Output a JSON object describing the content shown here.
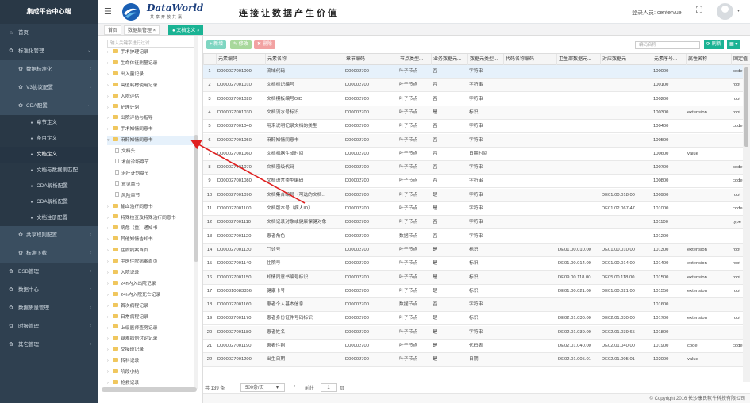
{
  "sidebar": {
    "brand": "集成平台中心端",
    "items": [
      {
        "label": "首页",
        "icon": "home-icon",
        "glyph": "⌂",
        "level": 1,
        "chev": ""
      },
      {
        "label": "标准化管理",
        "icon": "gear-icon",
        "glyph": "✿",
        "level": 1,
        "chev": "⌄"
      },
      {
        "label": "数据标准化",
        "icon": "gear-icon",
        "glyph": "✿",
        "level": 2,
        "chev": "‹"
      },
      {
        "label": "V3协议配置",
        "icon": "gear-icon",
        "glyph": "✿",
        "level": 2,
        "chev": "‹"
      },
      {
        "label": "CDA配置",
        "icon": "gear-icon",
        "glyph": "✿",
        "level": 2,
        "chev": "⌄"
      },
      {
        "label": "章节定义",
        "icon": "circle-icon",
        "glyph": "●",
        "level": 3
      },
      {
        "label": "条目定义",
        "icon": "circle-icon",
        "glyph": "●",
        "level": 3
      },
      {
        "label": "文档定义",
        "icon": "circle-icon",
        "glyph": "●",
        "level": 3,
        "active": true
      },
      {
        "label": "文档与数据集匹配",
        "icon": "circle-icon",
        "glyph": "●",
        "level": 3
      },
      {
        "label": "CDA解析配置",
        "icon": "circle-icon",
        "glyph": "●",
        "level": 3
      },
      {
        "label": "CDA解析配置",
        "icon": "circle-icon",
        "glyph": "●",
        "level": 3
      },
      {
        "label": "文档注册配置",
        "icon": "circle-icon",
        "glyph": "●",
        "level": 3
      },
      {
        "label": "共享规则配置",
        "icon": "gear-icon",
        "glyph": "✿",
        "level": 2,
        "chev": "‹"
      },
      {
        "label": "标准下载",
        "icon": "gear-icon",
        "glyph": "✿",
        "level": 2,
        "chev": "‹"
      },
      {
        "label": "ESB管理",
        "icon": "gear-icon",
        "glyph": "✿",
        "level": 1,
        "chev": "‹"
      },
      {
        "label": "数据中心",
        "icon": "gear-icon",
        "glyph": "✿",
        "level": 1,
        "chev": "‹"
      },
      {
        "label": "数据质量管理",
        "icon": "gear-icon",
        "glyph": "✿",
        "level": 1,
        "chev": "‹"
      },
      {
        "label": "时报管理",
        "icon": "gear-icon",
        "glyph": "✿",
        "level": 1,
        "chev": "‹"
      },
      {
        "label": "其它管理",
        "icon": "gear-icon",
        "glyph": "✿",
        "level": 1,
        "chev": "‹"
      }
    ]
  },
  "header": {
    "logo_text": "DataWorld",
    "logo_sub": "共享开放共赢",
    "slogan": "连接让数据产生价值",
    "login_label": "登录人员: centervue",
    "expand_icon": "⛶",
    "caret": "▾"
  },
  "tabs": [
    {
      "label": "首页"
    },
    {
      "label": "数据集管理 ×"
    },
    {
      "label": "● 文档定义 ×",
      "active": true
    }
  ],
  "tree": {
    "search_placeholder": "输入关键字进行过滤",
    "nodes": [
      {
        "label": "手术护理记录",
        "type": "folder"
      },
      {
        "label": "生命体征测量记录",
        "type": "folder"
      },
      {
        "label": "出入量记录",
        "type": "folder"
      },
      {
        "label": "高值耗材使用记录",
        "type": "folder"
      },
      {
        "label": "入院评估",
        "type": "folder"
      },
      {
        "label": "护理计划",
        "type": "folder"
      },
      {
        "label": "出院评估与指导",
        "type": "folder"
      },
      {
        "label": "手术知情同意书",
        "type": "folder"
      },
      {
        "label": "麻醉知情同意书",
        "type": "folder",
        "expanded": true
      },
      {
        "label": "文档头",
        "type": "file"
      },
      {
        "label": "术前诊断章节",
        "type": "file"
      },
      {
        "label": "治疗计划章节",
        "type": "file"
      },
      {
        "label": "意见章节",
        "type": "file"
      },
      {
        "label": "风险章节",
        "type": "file"
      },
      {
        "label": "输血治疗同意书",
        "type": "folder"
      },
      {
        "label": "特殊检查及特殊治疗同意书",
        "type": "folder"
      },
      {
        "label": "病危（重）通知书",
        "type": "folder"
      },
      {
        "label": "其他知情告知书",
        "type": "folder"
      },
      {
        "label": "住院病案首页",
        "type": "folder"
      },
      {
        "label": "中医住院病案首页",
        "type": "folder"
      },
      {
        "label": "入院记录",
        "type": "folder"
      },
      {
        "label": "24h内入出院记录",
        "type": "folder"
      },
      {
        "label": "24h内入院死亡记录",
        "type": "folder"
      },
      {
        "label": "首次病程记录",
        "type": "folder"
      },
      {
        "label": "日常病程记录",
        "type": "folder"
      },
      {
        "label": "上级医师查房记录",
        "type": "folder"
      },
      {
        "label": "疑难病例讨论记录",
        "type": "folder"
      },
      {
        "label": "交接班记录",
        "type": "folder"
      },
      {
        "label": "转科记录",
        "type": "folder"
      },
      {
        "label": "阶段小结",
        "type": "folder"
      },
      {
        "label": "抢救记录",
        "type": "folder"
      }
    ]
  },
  "toolbar": {
    "add": "+ 新增",
    "edit": "✎ 修改",
    "delete": "✖ 删除",
    "search_placeholder": "编码名称",
    "refresh": "⟳ 刷新",
    "grid": "▦ ▾"
  },
  "table": {
    "columns": [
      "",
      "元素编码",
      "元素名称",
      "章节编码",
      "节点类型...",
      "业务数据元...",
      "数据元类型...",
      "代码名称编码",
      "卫生部数据元...",
      "对应数据元",
      "元素序号...",
      "属性名称",
      "固定值"
    ],
    "rows": [
      [
        "1",
        "D000027001000",
        "流域代码",
        "D00002700",
        "叶子节点",
        "否",
        "字符串",
        "",
        "",
        "",
        "100000",
        "",
        "code"
      ],
      [
        "2",
        "D000027001010",
        "文档标识编号",
        "D00002700",
        "叶子节点",
        "否",
        "字符串",
        "",
        "",
        "",
        "100100",
        "",
        "root"
      ],
      [
        "3",
        "D000027001020",
        "文档模板编号OID",
        "D00002700",
        "叶子节点",
        "否",
        "字符串",
        "",
        "",
        "",
        "100200",
        "",
        "root"
      ],
      [
        "4",
        "D000027001030",
        "文档流水号标识",
        "D00002700",
        "叶子节点",
        "是",
        "标识",
        "",
        "",
        "",
        "100300",
        "extension",
        "root"
      ],
      [
        "5",
        "D000027001040",
        "用来说明记录文档的类型",
        "D00002700",
        "叶子节点",
        "否",
        "字符串",
        "",
        "",
        "",
        "100400",
        "",
        "code"
      ],
      [
        "6",
        "D000027001050",
        "麻醉知情同意书",
        "D00002700",
        "叶子节点",
        "否",
        "字符串",
        "",
        "",
        "",
        "100500",
        "",
        ""
      ],
      [
        "7",
        "D000027001060",
        "文档机器生成时间",
        "D00002700",
        "叶子节点",
        "否",
        "日期时间",
        "",
        "",
        "",
        "100600",
        "value",
        ""
      ],
      [
        "8",
        "D000027001070",
        "文档密级代码",
        "D00002700",
        "叶子节点",
        "否",
        "字符串",
        "",
        "",
        "",
        "100700",
        "",
        "code"
      ],
      [
        "9",
        "D000027001080",
        "文档语言类型编码",
        "D00002700",
        "叶子节点",
        "否",
        "字符串",
        "",
        "",
        "",
        "100800",
        "",
        "code"
      ],
      [
        "10",
        "D000027001090",
        "文档集合编号（可选的文档...",
        "D00002700",
        "叶子节点",
        "是",
        "字符串",
        "",
        "",
        "DE01.00.018.00",
        "100900",
        "",
        "root"
      ],
      [
        "11",
        "D000027001100",
        "文档版本号（病人ID）",
        "D00002700",
        "叶子节点",
        "是",
        "字符串",
        "",
        "",
        "DE01.02.067.47",
        "101000",
        "",
        "code"
      ],
      [
        "12",
        "D000027001110",
        "文档记录对象或健康保健对象",
        "D00002700",
        "叶子节点",
        "否",
        "字符串",
        "",
        "",
        "",
        "101100",
        "",
        "type"
      ],
      [
        "13",
        "D000027001120",
        "患者角色",
        "D00002700",
        "数据节点",
        "否",
        "字符串",
        "",
        "",
        "",
        "101200",
        "",
        ""
      ],
      [
        "14",
        "D000027001130",
        "门诊号",
        "D00002700",
        "叶子节点",
        "是",
        "标识",
        "",
        "DE01.00.010.00",
        "DE01.00.010.00",
        "101300",
        "extension",
        "root"
      ],
      [
        "15",
        "D000027001140",
        "住院号",
        "D00002700",
        "叶子节点",
        "是",
        "标识",
        "",
        "DE01.00.014.00",
        "DE01.00.014.00",
        "101400",
        "extension",
        "root"
      ],
      [
        "16",
        "D000027001150",
        "知情同意书编号标识",
        "D00002700",
        "叶子节点",
        "是",
        "标识",
        "",
        "DE09.00.118.00",
        "DE05.00.118.00",
        "101500",
        "extension",
        "root"
      ],
      [
        "17",
        "D000810083356",
        "健康卡号",
        "D00002700",
        "叶子节点",
        "是",
        "标识",
        "",
        "DE01.00.021.00",
        "DE01.00.021.00",
        "101550",
        "extension",
        "root"
      ],
      [
        "18",
        "D000027001160",
        "患者个人基本信息",
        "D00002700",
        "数据节点",
        "否",
        "字符串",
        "",
        "",
        "",
        "101600",
        "",
        ""
      ],
      [
        "19",
        "D000027001170",
        "患者身份证件号码标识",
        "D00002700",
        "叶子节点",
        "是",
        "标识",
        "",
        "DE02.01.030.00",
        "DE02.01.030.00",
        "101700",
        "extension",
        "root"
      ],
      [
        "20",
        "D000027001180",
        "患者姓名",
        "D00002700",
        "叶子节点",
        "是",
        "字符串",
        "",
        "DE02.01.039.00",
        "DE02.01.039.65",
        "101800",
        "",
        ""
      ],
      [
        "21",
        "D000027001190",
        "患者性别",
        "D00002700",
        "叶子节点",
        "是",
        "代码表",
        "",
        "DE02.01.040.00",
        "DE02.01.040.00",
        "101900",
        "code",
        "code"
      ],
      [
        "22",
        "D000027001200",
        "出生日期",
        "D00002700",
        "叶子节点",
        "是",
        "日期",
        "",
        "DE02.01.005.01",
        "DE02.01.005.01",
        "102000",
        "value",
        ""
      ]
    ]
  },
  "pager": {
    "total": "共 139 条",
    "size": "500条/页",
    "size_caret": "▾",
    "prev": "‹",
    "goto": "前往",
    "page": "1",
    "unit": "页"
  },
  "footer": {
    "copyright": "© Copyright 2016 长沙康氏软件科技有限公司"
  },
  "colors": {
    "sidebar": "#2f4050",
    "accent": "#1ab394",
    "add": "#7fd6c2",
    "edit": "#a8d89c",
    "delete": "#f2a2a2",
    "arrow": "#e02020"
  }
}
